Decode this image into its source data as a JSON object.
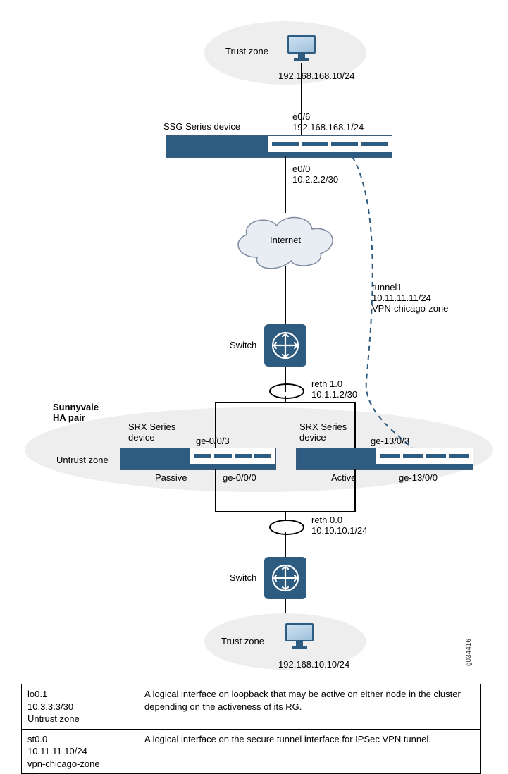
{
  "top": {
    "trust_zone": "Trust zone",
    "host_ip": "192.168.168.10/24",
    "ssg_label": "SSG Series device",
    "ssg_if_top_name": "e0/6",
    "ssg_if_top_ip": "192.168.168.1/24",
    "ssg_if_bot_name": "e0/0",
    "ssg_if_bot_ip": "10.2.2.2/30"
  },
  "internet": "Internet",
  "tunnel": {
    "name": "tunnel1",
    "ip": "10.11.11.11/24",
    "zone": "VPN-chicago-zone"
  },
  "switch_top": "Switch",
  "reth1": {
    "name": "reth 1.0",
    "ip": "10.1.1.2/30"
  },
  "ha": {
    "title_l1": "Sunnyvale",
    "title_l2": "HA pair",
    "srx_label": "SRX Series",
    "srx_label2": "device",
    "untrust": "Untrust zone",
    "passive": "Passive",
    "active": "Active",
    "p_top": "ge-0/0/3",
    "p_bot": "ge-0/0/0",
    "a_top": "ge-13/0/3",
    "a_bot": "ge-13/0/0"
  },
  "reth0": {
    "name": "reth 0.0",
    "ip": "10.10.10.1/24"
  },
  "switch_bot": "Switch",
  "bottom": {
    "trust_zone": "Trust zone",
    "host_ip": "192.168.10.10/24"
  },
  "img_id": "g034416",
  "table": {
    "r1": {
      "if": "lo0.1",
      "ip": "10.3.3.3/30",
      "zone": "Untrust zone",
      "desc": "A logical interface on loopback that may be active on either node in the cluster depending on the activeness of its RG."
    },
    "r2": {
      "if": "st0.0",
      "ip": "10.11.11.10/24",
      "zone": "vpn-chicago-zone",
      "desc": "A logical interface on the secure tunnel interface for IPSec VPN tunnel."
    }
  }
}
